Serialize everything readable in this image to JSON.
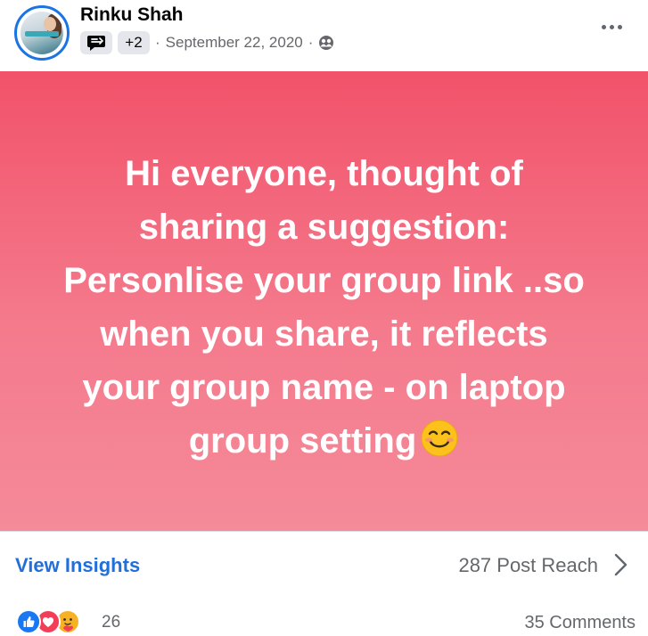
{
  "post": {
    "author": "Rinku Shah",
    "badge_extra": "+2",
    "date": "September 22, 2020",
    "privacy_icon": "members-icon",
    "text_lines": [
      "Hi everyone, thought of",
      "sharing a suggestion:",
      "Personlise your group link ..so",
      "when you share, it reflects",
      "your group name - on laptop",
      "group setting"
    ],
    "emoji": "smiling-face-icon",
    "background_colors": [
      "#f2526a",
      "#f58a99"
    ]
  },
  "insights": {
    "link_label": "View Insights",
    "reach_label": "287 Post Reach"
  },
  "engagement": {
    "reaction_icons": [
      "like-icon",
      "love-icon",
      "care-icon"
    ],
    "reaction_count": "26",
    "comments_label": "35 Comments"
  },
  "colors": {
    "accent": "#216fdb",
    "secondary_text": "#65676b"
  }
}
